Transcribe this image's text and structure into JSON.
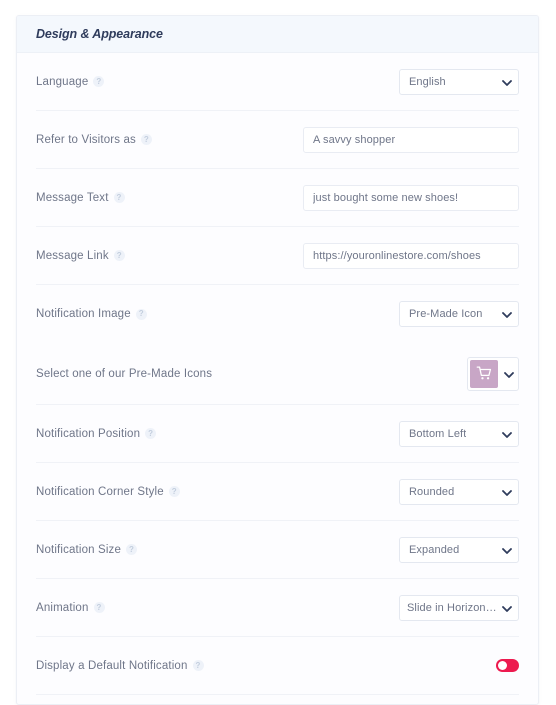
{
  "card": {
    "title": "Design & Appearance"
  },
  "icons": {
    "help": "?",
    "chevron_down": "chevron-down-icon",
    "cart": "shopping-cart-icon"
  },
  "colors": {
    "header_bg": "#f4f8fd",
    "title": "#2f3c5c",
    "label": "#6f7689",
    "border": "#e4e8f0",
    "icon_swatch": "#c8a6c6",
    "toggle_on": "#ed1a4f"
  },
  "rows": {
    "language": {
      "label": "Language",
      "value": "English"
    },
    "refer_to_visitors": {
      "label": "Refer to Visitors as",
      "value": "A savvy shopper",
      "placeholder": "A savvy shopper"
    },
    "message_text": {
      "label": "Message Text",
      "value": "just bought some new shoes!",
      "placeholder": "just bought some new shoes!"
    },
    "message_link": {
      "label": "Message Link",
      "value": "https://youronlinestore.com/shoes",
      "placeholder": "https://youronlinestore.com/shoes"
    },
    "notification_image": {
      "label": "Notification Image",
      "value": "Pre-Made Icon"
    },
    "premade_icons": {
      "label": "Select one of our Pre-Made Icons",
      "value": "shopping-cart-icon"
    },
    "notification_position": {
      "label": "Notification Position",
      "value": "Bottom Left"
    },
    "notification_corner_style": {
      "label": "Notification Corner Style",
      "value": "Rounded"
    },
    "notification_size": {
      "label": "Notification Size",
      "value": "Expanded"
    },
    "animation": {
      "label": "Animation",
      "value": "Slide in Horizontally"
    },
    "default_notification": {
      "label": "Display a Default Notification",
      "value": "on"
    }
  }
}
